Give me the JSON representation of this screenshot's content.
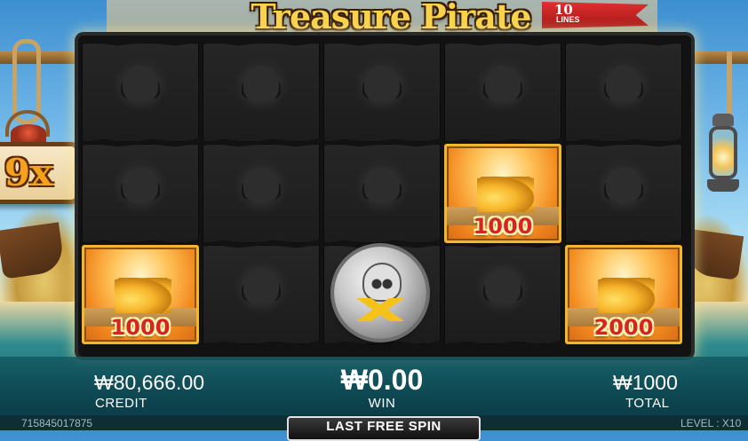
{
  "game": {
    "title": "Treasure Pirate",
    "lines_number": "10",
    "lines_label": "LINES"
  },
  "multiplier": "9x",
  "grid": {
    "rows": [
      [
        {
          "symbol": "pirate-flag"
        },
        {
          "symbol": "pirate-flag"
        },
        {
          "symbol": "pirate-flag"
        },
        {
          "symbol": "pirate-flag"
        },
        {
          "symbol": "pirate-flag"
        }
      ],
      [
        {
          "symbol": "pirate-flag"
        },
        {
          "symbol": "pirate-flag"
        },
        {
          "symbol": "pirate-flag"
        },
        {
          "symbol": "gold-coins",
          "value": "1000"
        },
        {
          "symbol": "pirate-flag"
        }
      ],
      [
        {
          "symbol": "gold-coins",
          "value": "1000"
        },
        {
          "symbol": "pirate-flag"
        },
        {
          "symbol": "silver-skull-coin"
        },
        {
          "symbol": "pirate-flag"
        },
        {
          "symbol": "gold-coins",
          "value": "2000"
        }
      ]
    ]
  },
  "stats": {
    "credit_value": "₩80,666.00",
    "credit_label": "CREDIT",
    "win_value": "₩0.00",
    "win_label": "WIN",
    "total_value": "₩1000",
    "total_label": "TOTAL"
  },
  "footer": {
    "game_id": "715845017875",
    "last_spin_label": "LAST FREE SPIN",
    "level": "LEVEL : X10"
  },
  "colors": {
    "gold_frame": "#f2b72c",
    "value_red": "#d62323",
    "title_gold": "#f7d24a"
  }
}
